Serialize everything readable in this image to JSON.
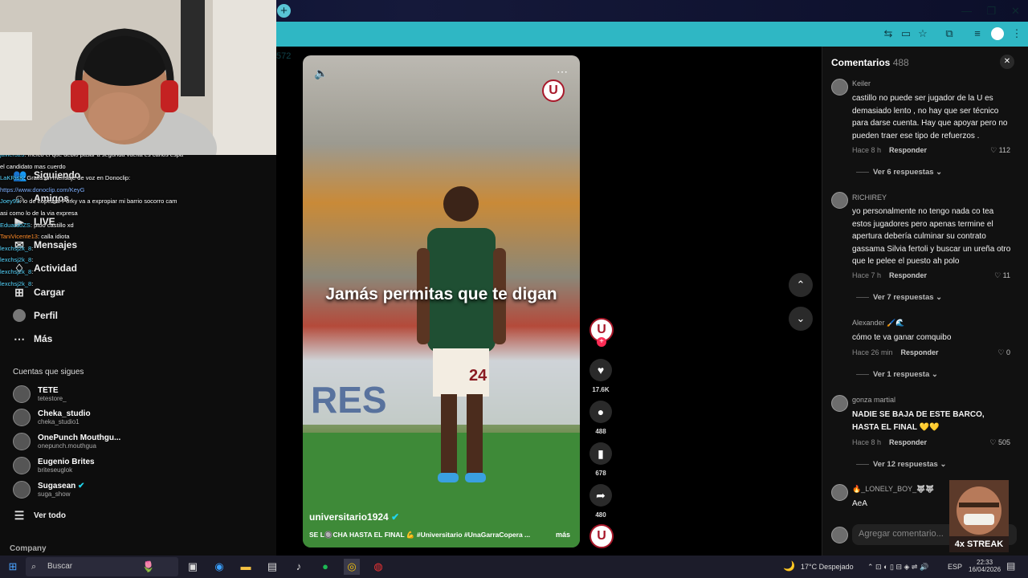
{
  "browser": {
    "url": "572"
  },
  "sidebar": {
    "nav": [
      {
        "icon": "following-icon",
        "label": "Siguiendo"
      },
      {
        "icon": "friends-icon",
        "label": "Amigos"
      },
      {
        "icon": "live-icon",
        "label": "LIVE"
      },
      {
        "icon": "messages-icon",
        "label": "Mensajes"
      },
      {
        "icon": "activity-icon",
        "label": "Actividad"
      },
      {
        "icon": "upload-icon",
        "label": "Cargar"
      },
      {
        "icon": "profile-icon",
        "label": "Perfil"
      },
      {
        "icon": "more-icon",
        "label": "Más"
      }
    ],
    "following_title": "Cuentas que sigues",
    "accounts": [
      {
        "name": "TETE",
        "handle": "tetestore_"
      },
      {
        "name": "Cheka_studio",
        "handle": "cheka_studio1"
      },
      {
        "name": "OnePunch Mouthgu...",
        "handle": "onepunch.mouthgua"
      },
      {
        "name": "Eugenio Brites",
        "handle": "briteseuglok"
      },
      {
        "name": "Sugasean",
        "handle": "suga_show"
      }
    ],
    "see_all": "Ver todo",
    "company": "Company"
  },
  "chat": [
    {
      "user": "javier323",
      "text": ": Inelco el que debio pasar a segunda vuelta es carlos espa el candidato mas cuerdo"
    },
    {
      "user": "LaKRisK",
      "text": ": Gratis un mensaje de voz en Donoclip:",
      "link": "https://www.donoclip.com/KeyG"
    },
    {
      "user": "Joey93",
      "text": ": lo de Lopez al Porky va a expropiar mi barrio socorro cam asi como lo de la via expresa"
    },
    {
      "user": "EduardoZS",
      "text": ": ptoo castillo xd"
    },
    {
      "user": "TaniVicente13",
      "text": ": calla idiota"
    },
    {
      "user": "lexchsj2k_8",
      "text": ":"
    },
    {
      "user": "lexchsj2k_8",
      "text": ":"
    },
    {
      "user": "lexchsj2k_8",
      "text": ":"
    },
    {
      "user": "lexchsj2k_8",
      "text": ":"
    }
  ],
  "video": {
    "caption": "Jamás permitas que te digan",
    "author": "universitario1924",
    "description": "SE L🔘CHA HASTA EL FINAL 💪 #Universitario #UnaGarraCopera ...",
    "more": "más",
    "jersey_number": "24",
    "likes": "17.6K",
    "comments": "488",
    "saves": "678",
    "shares": "480"
  },
  "comments_panel": {
    "title": "Comentarios",
    "count": "488",
    "items": [
      {
        "user": "Keiler",
        "text": "castillo no puede ser jugador de la U es demasiado lento , no hay que ser técnico para darse cuenta. Hay que apoyar pero no pueden traer ese tipo de refuerzos .",
        "time": "Hace 8 h",
        "reply": "Responder",
        "likes": "112",
        "replies": "Ver 6 respuestas"
      },
      {
        "user": "RICHIREY",
        "text": "yo personalmente no tengo nada co tea estos jugadores pero apenas termine el apertura debería culminar su contrato gassama Silvia fertoli y buscar un ureña otro que le pelee el puesto ah polo",
        "time": "Hace 7 h",
        "reply": "Responder",
        "likes": "11",
        "replies": "Ver 7 respuestas"
      },
      {
        "user": "Alexander 🖌️🌊",
        "text": "cómo te va ganar comquibo",
        "time": "Hace 26 min",
        "reply": "Responder",
        "likes": "0",
        "replies": "Ver 1 respuesta"
      },
      {
        "user": "gonza martial",
        "text": "NADIE SE BAJA DE ESTE BARCO, HASTA EL FINAL 💛💛",
        "time": "Hace 8 h",
        "reply": "Responder",
        "likes": "505",
        "replies": "Ver 12 respuestas"
      },
      {
        "user": "🔥_LONELY_BOY_🐺🐺",
        "text": "AeA"
      }
    ],
    "input_placeholder": "Agregar comentario...",
    "streak": "4x STREAK"
  },
  "taskbar": {
    "search": "Buscar",
    "weather": "17°C  Despejado",
    "lang": "ESP",
    "time": "22:33",
    "date": "16/04/2026"
  }
}
